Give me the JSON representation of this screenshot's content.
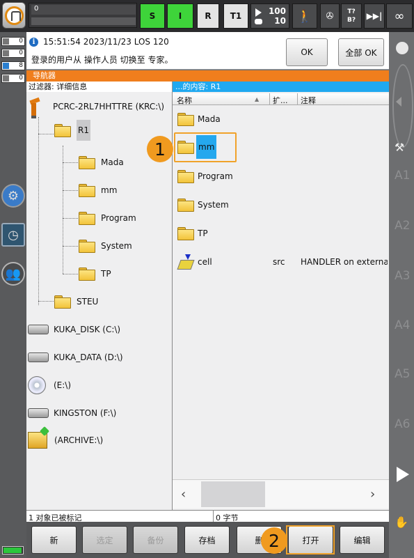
{
  "topbar": {
    "program_line": "0",
    "btn_s": "S",
    "btn_i": "I",
    "btn_r": "R",
    "btn_t1": "T1",
    "override_prog": "100",
    "override_jog": "10",
    "tool_base_t": "T?",
    "tool_base_b": "B?",
    "skip_symbol": "▶▶|",
    "infinity_symbol": "∞"
  },
  "counters": [
    {
      "icon": "error-icon",
      "value": "0"
    },
    {
      "icon": "warning-icon",
      "value": "0"
    },
    {
      "icon": "info-icon",
      "value": "8"
    },
    {
      "icon": "wait-icon",
      "value": "0"
    }
  ],
  "message": {
    "timestamp": "15:51:54 2023/11/23 LOS 120",
    "text": "登录的用户从 操作人员 切换至 专家。",
    "ok_label": "OK",
    "all_ok_label": "全部 OK"
  },
  "navigator": {
    "title": "导航器",
    "filter_label": "过滤器: 详细信息",
    "content_label": "...的内容: R1"
  },
  "tree": {
    "root": "PCRC-2RL7HHTTRE (KRC:\\)",
    "r1": "R1",
    "children": [
      "Mada",
      "mm",
      "Program",
      "System",
      "TP"
    ],
    "steu": "STEU",
    "drives": [
      {
        "label": "KUKA_DISK (C:\\)",
        "icon": "hard-drive-icon"
      },
      {
        "label": "KUKA_DATA (D:\\)",
        "icon": "hard-drive-icon"
      },
      {
        "label": "(E:\\)",
        "icon": "cd-drive-icon"
      },
      {
        "label": "KINGSTON (F:\\)",
        "icon": "usb-drive-icon"
      },
      {
        "label": "(ARCHIVE:\\)",
        "icon": "archive-icon"
      }
    ]
  },
  "content": {
    "columns": [
      "名称",
      "扩...",
      "注释"
    ],
    "rows": [
      {
        "name": "Mada",
        "ext": "",
        "comment": "",
        "icon": "folder-icon"
      },
      {
        "name": "mm",
        "ext": "",
        "comment": "",
        "icon": "folder-icon",
        "selected": true
      },
      {
        "name": "Program",
        "ext": "",
        "comment": "",
        "icon": "folder-icon"
      },
      {
        "name": "System",
        "ext": "",
        "comment": "",
        "icon": "folder-icon"
      },
      {
        "name": "TP",
        "ext": "",
        "comment": "",
        "icon": "folder-icon"
      },
      {
        "name": "cell",
        "ext": "src",
        "comment": "HANDLER on external ...",
        "icon": "source-file-icon"
      }
    ]
  },
  "status": {
    "selection": "1 对象已被标记",
    "bytes": "0 字节"
  },
  "softkeys": {
    "new": "新",
    "select": "选定",
    "backup": "备份",
    "archive": "存档",
    "delete": "删",
    "open": "打开",
    "edit": "编辑"
  },
  "callouts": {
    "step1": "1",
    "step2": "2"
  },
  "axes": [
    "A1",
    "A2",
    "A3",
    "A4",
    "A5",
    "A6"
  ],
  "colors": {
    "accent_orange": "#f07e1d",
    "selection_blue": "#25a8ee",
    "status_green": "#3ed43a",
    "callout": "#f09a1f"
  }
}
